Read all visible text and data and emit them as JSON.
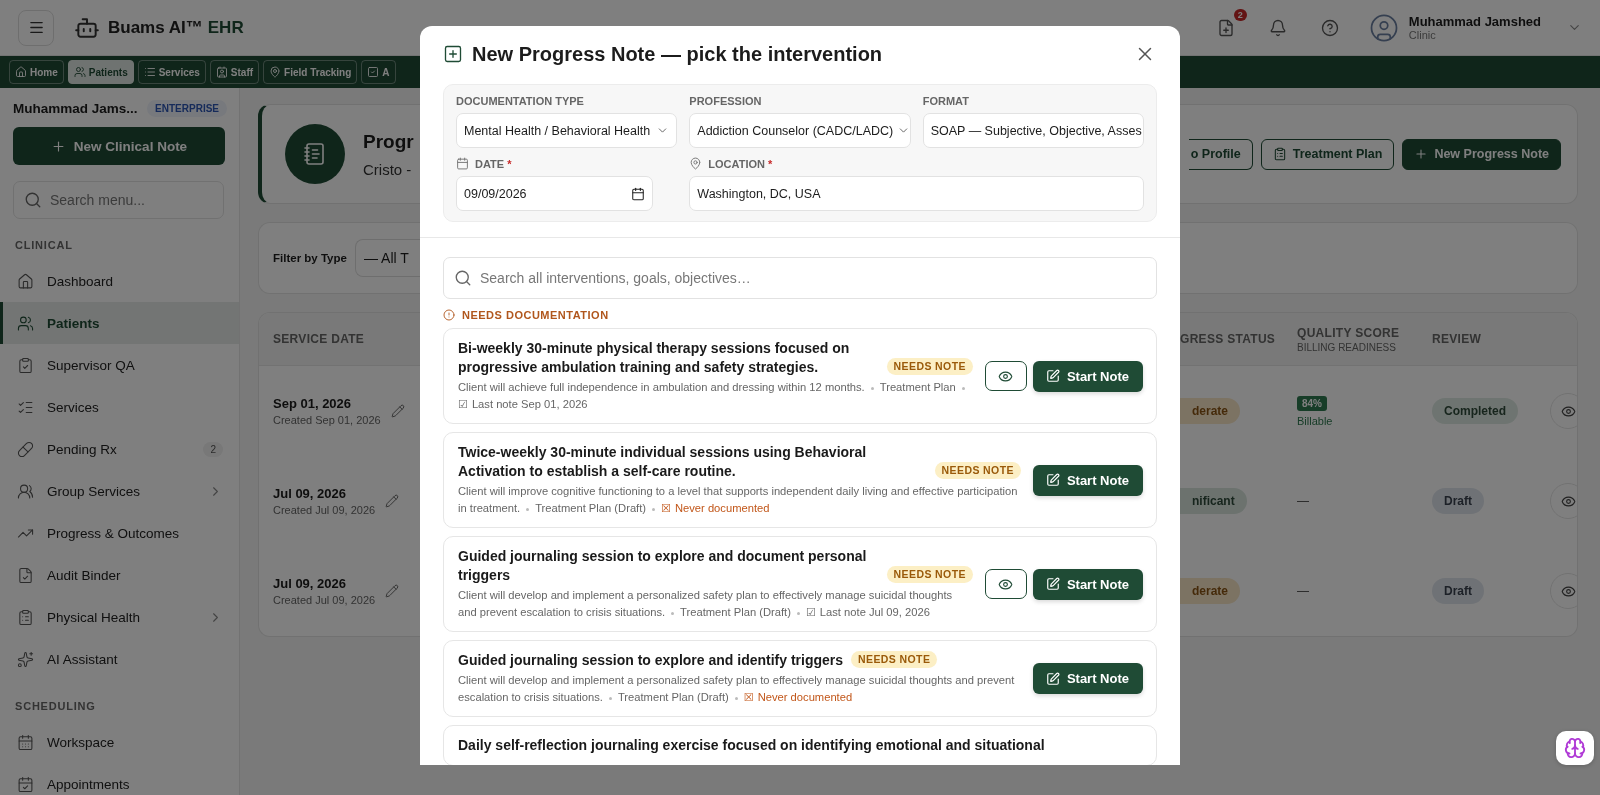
{
  "app": {
    "brand": "Buams AI™",
    "brand_suffix": "EHR"
  },
  "header": {
    "rx_count": "2",
    "user_name": "Muhammad Jamshed",
    "user_role": "Clinic"
  },
  "nav_tabs": [
    {
      "label": "Home",
      "selected": false
    },
    {
      "label": "Patients",
      "selected": true
    },
    {
      "label": "Services",
      "selected": false
    },
    {
      "label": "Staff",
      "selected": false
    },
    {
      "label": "Field Tracking",
      "selected": false
    },
    {
      "label": "A",
      "selected": false
    }
  ],
  "sidebar": {
    "user": "Muhammad Jams...",
    "plan": "ENTERPRISE",
    "new_button": "New Clinical Note",
    "search_placeholder": "Search menu...",
    "sections": [
      {
        "title": "CLINICAL",
        "items": [
          {
            "label": "Dashboard",
            "selected": false,
            "submenu": false
          },
          {
            "label": "Patients",
            "selected": true,
            "submenu": false
          },
          {
            "label": "Supervisor QA",
            "selected": false,
            "submenu": false
          },
          {
            "label": "Services",
            "selected": false,
            "submenu": false
          },
          {
            "label": "Pending Rx",
            "selected": false,
            "submenu": false,
            "count": "2"
          },
          {
            "label": "Group Services",
            "selected": false,
            "submenu": true
          },
          {
            "label": "Progress & Outcomes",
            "selected": false,
            "submenu": false
          },
          {
            "label": "Audit Binder",
            "selected": false,
            "submenu": false
          },
          {
            "label": "Physical Health",
            "selected": false,
            "submenu": true
          },
          {
            "label": "AI Assistant",
            "selected": false,
            "submenu": false
          }
        ]
      },
      {
        "title": "SCHEDULING",
        "items": [
          {
            "label": "Workspace",
            "selected": false,
            "submenu": false
          },
          {
            "label": "Appointments",
            "selected": false,
            "submenu": false
          }
        ]
      }
    ]
  },
  "page": {
    "title": "Progr",
    "subtitle": "Cristo -",
    "actions": [
      {
        "label": "o Profile",
        "kind": "outline",
        "clipped": true
      },
      {
        "label": "Treatment Plan",
        "kind": "outline",
        "clipped": false
      },
      {
        "label": "New Progress Note",
        "kind": "primary",
        "clipped": false
      }
    ],
    "filter_label": "Filter by Type",
    "filter_value": "— All T",
    "table": {
      "first_column": "SERVICE DATE",
      "columns": [
        {
          "label": "GRESS STATUS"
        },
        {
          "label": "QUALITY SCORE",
          "sublabel": "BILLING READINESS"
        },
        {
          "label": "REVIEW"
        }
      ],
      "rows": [
        {
          "date": "Sep 01, 2026",
          "created": "Created Sep 01, 2026",
          "status": {
            "text": "derate",
            "kind": "warning"
          },
          "quality": {
            "kind": "score",
            "score": "84%",
            "label": "Billable"
          },
          "review": {
            "text": "Completed",
            "kind": "done"
          }
        },
        {
          "date": "Jul 09, 2026",
          "created": "Created Jul 09, 2026",
          "status": {
            "text": "nificant",
            "kind": "success"
          },
          "quality": {
            "kind": "none",
            "text": "—"
          },
          "review": {
            "text": "Draft",
            "kind": "draft"
          }
        },
        {
          "date": "Jul 09, 2026",
          "created": "Created Jul 09, 2026",
          "status": {
            "text": "derate",
            "kind": "warning"
          },
          "quality": {
            "kind": "none",
            "text": "—"
          },
          "review": {
            "text": "Draft",
            "kind": "draft"
          }
        }
      ]
    }
  },
  "modal": {
    "title": "New Progress Note — pick the intervention",
    "fields": [
      {
        "label": "DOCUMENTATION TYPE",
        "value": "Mental Health / Behavioral Health",
        "kind": "select"
      },
      {
        "label": "PROFESSION",
        "value": "Addiction Counselor (CADC/LADC)",
        "kind": "select"
      },
      {
        "label": "FORMAT",
        "value": "SOAP — Subjective, Objective, Asses",
        "kind": "text"
      },
      {
        "label": "DATE",
        "value": "09/09/2026",
        "kind": "date",
        "required_mark": "*"
      },
      {
        "label": "LOCATION",
        "value": "Washington, DC, USA",
        "kind": "location",
        "required_mark": "*"
      }
    ],
    "search_placeholder": "Search all interventions, goals, objectives…",
    "section_label": "NEEDS DOCUMENTATION",
    "interventions": [
      {
        "title": "Bi-weekly 30-minute physical therapy sessions focused on progressive ambulation training and safety strategies.",
        "badge": "NEEDS NOTE",
        "goal": "Client will achieve full independence in ambulation and dressing within 12 months.",
        "source": "Treatment Plan",
        "note_status": {
          "kind": "last_note",
          "icon": "☑",
          "text": "Last note Sep 01, 2026"
        },
        "preview": true,
        "action": "Start Note"
      },
      {
        "title": "Twice-weekly 30-minute individual sessions using Behavioral Activation to establish a self-care routine.",
        "badge": "NEEDS NOTE",
        "goal": "Client will improve cognitive functioning to a level that supports independent daily living and effective participation in treatment.",
        "source": "Treatment Plan (Draft)",
        "note_status": {
          "kind": "never",
          "icon": "☒",
          "text": "Never documented"
        },
        "preview": false,
        "action": "Start Note"
      },
      {
        "title": "Guided journaling session to explore and document personal triggers",
        "badge": "NEEDS NOTE",
        "goal": "Client will develop and implement a personalized safety plan to effectively manage suicidal thoughts and prevent escalation to crisis situations.",
        "source": "Treatment Plan (Draft)",
        "note_status": {
          "kind": "last_note",
          "icon": "☑",
          "text": "Last note Jul 09, 2026"
        },
        "preview": true,
        "action": "Start Note"
      },
      {
        "title": "Guided journaling session to explore and identify triggers",
        "badge": "NEEDS NOTE",
        "goal": "Client will develop and implement a personalized safety plan to effectively manage suicidal thoughts and prevent escalation to crisis situations.",
        "source": "Treatment Plan (Draft)",
        "note_status": {
          "kind": "never",
          "icon": "☒",
          "text": "Never documented"
        },
        "preview": false,
        "action": "Start Note"
      },
      {
        "title": "Daily self-reflection journaling exercise focused on identifying emotional and situational"
      }
    ]
  }
}
